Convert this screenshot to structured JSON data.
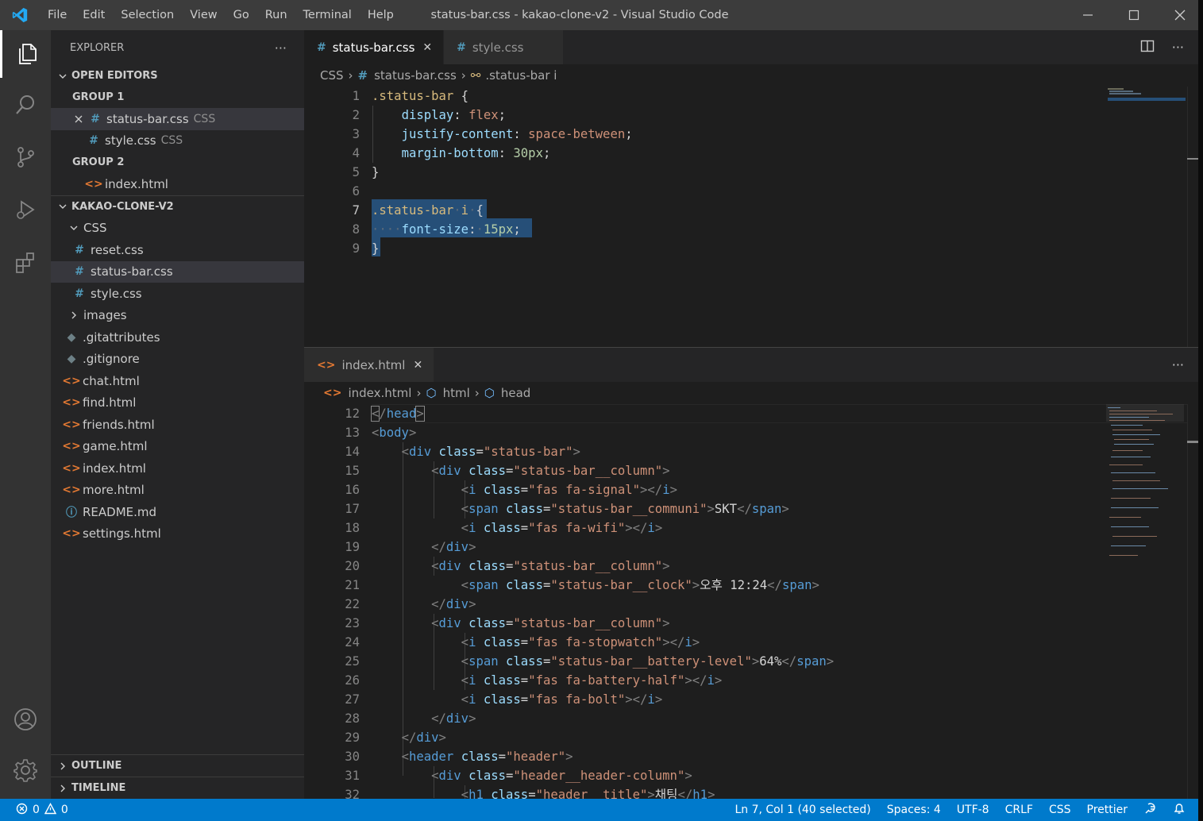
{
  "window": {
    "title": "status-bar.css - kakao-clone-v2 - Visual Studio Code",
    "menu": [
      "File",
      "Edit",
      "Selection",
      "View",
      "Go",
      "Run",
      "Terminal",
      "Help"
    ]
  },
  "sidebar": {
    "title": "EXPLORER",
    "more": "···",
    "open_editors": {
      "label": "OPEN EDITORS",
      "group1": "GROUP 1",
      "group1_items": [
        {
          "name": "status-bar.css",
          "desc": "CSS"
        },
        {
          "name": "style.css",
          "desc": "CSS"
        }
      ],
      "group2": "GROUP 2",
      "group2_items": [
        {
          "name": "index.html"
        }
      ]
    },
    "project": {
      "label": "KAKAO-CLONE-V2",
      "css_folder": "CSS",
      "css_files": [
        "reset.css",
        "status-bar.css",
        "style.css"
      ],
      "images_folder": "images",
      "files": [
        ".gitattributes",
        ".gitignore",
        "chat.html",
        "find.html",
        "friends.html",
        "game.html",
        "index.html",
        "more.html",
        "README.md",
        "settings.html"
      ]
    },
    "outline": "OUTLINE",
    "timeline": "TIMELINE"
  },
  "editor_top": {
    "tabs": [
      {
        "label": "status-bar.css",
        "active": true
      },
      {
        "label": "style.css",
        "active": false
      }
    ],
    "breadcrumbs": [
      "CSS",
      "status-bar.css",
      ".status-bar i"
    ],
    "line_numbers": [
      "1",
      "2",
      "3",
      "4",
      "5",
      "6",
      "7",
      "8",
      "9"
    ]
  },
  "editor_bottom": {
    "tabs": [
      {
        "label": "index.html",
        "active": false
      }
    ],
    "breadcrumbs": [
      "index.html",
      "html",
      "head"
    ],
    "line_numbers": [
      "12",
      "13",
      "14",
      "15",
      "16",
      "17",
      "18",
      "19",
      "20",
      "21",
      "22",
      "23",
      "24",
      "25",
      "26",
      "27",
      "28",
      "29",
      "30",
      "31",
      "32"
    ]
  },
  "statusbar": {
    "errors": "0",
    "warnings": "0",
    "position": "Ln 7, Col 1 (40 selected)",
    "spaces": "Spaces: 4",
    "encoding": "UTF-8",
    "eol": "CRLF",
    "language": "CSS",
    "formatter": "Prettier"
  },
  "colors": {
    "accent": "#007acc",
    "selection": "#264f78",
    "css_icon": "#519aba",
    "html_icon": "#e37933"
  }
}
